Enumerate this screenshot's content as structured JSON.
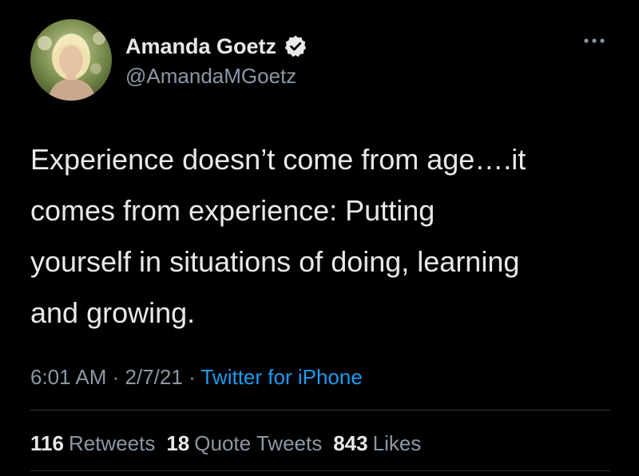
{
  "author": {
    "display_name": "Amanda Goetz",
    "handle": "@AmandaMGoetz"
  },
  "tweet": {
    "text": "Experience doesn’t come from age….it\ncomes from experience: Putting\nyourself in situations of doing, learning\nand growing.",
    "time": "6:01 AM",
    "separator": "·",
    "date": "2/7/21",
    "source": "Twitter for iPhone"
  },
  "stats": {
    "retweets_count": "116",
    "retweets_label": "Retweets",
    "quotes_count": "18",
    "quotes_label": "Quote Tweets",
    "likes_count": "843",
    "likes_label": "Likes"
  },
  "icons": {
    "verified": "verified-badge-icon",
    "more": "more-options-icon"
  },
  "colors": {
    "background": "#000000",
    "primary_text": "#e7e9ea",
    "secondary_text": "#8b98a5",
    "link": "#1d9bf0",
    "divider": "#2f3336"
  }
}
